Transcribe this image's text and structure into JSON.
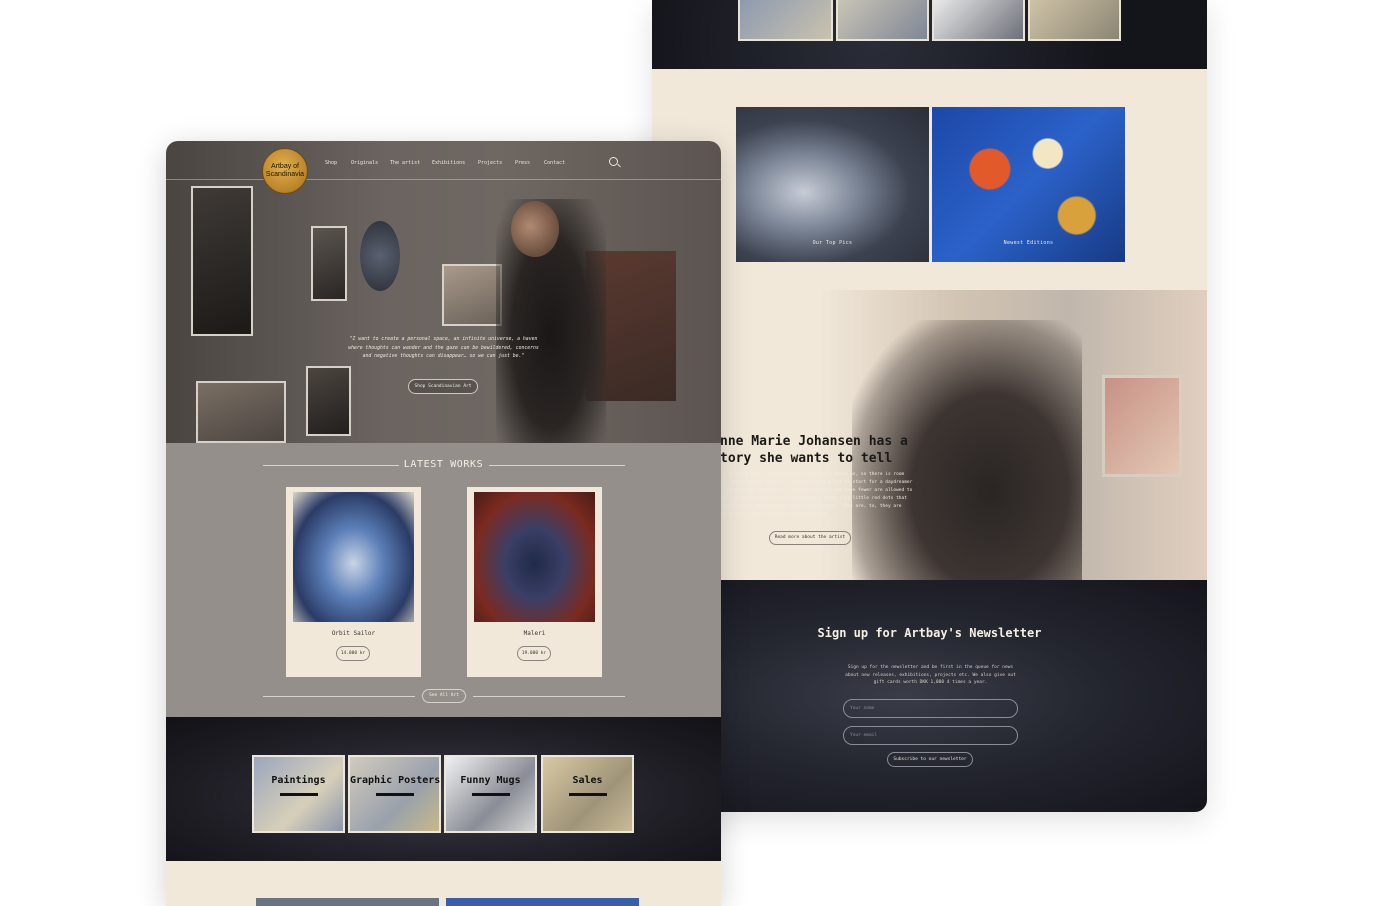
{
  "right": {
    "tiles": [
      {
        "label": "Our Top Pics"
      },
      {
        "label": "Newest Editions"
      }
    ],
    "story": {
      "headline_line1": "nne Marie Johansen has a",
      "headline_line2": "tory she wants to tell",
      "body": "'s about heaven, the great infinite space above us, so there is room for many stories and it is quite a good place to start for a daydreamer like her. Few insects are loved so fondly and even fewer are allowed to walk on your fingers, but ladybirds – those tiny little red dots that seem to keep wandering on your hand forever, they are, to, they are messengers, the carriers of good wishes.",
      "read_more": "Read more about the artist"
    },
    "newsletter": {
      "title": "Sign up for Artbay's Newsletter",
      "text": "Sign up for the newsletter and be first in the queue for news about new releases, exhibitions, projects etc. We also give out gift cards worth DKK 1,000 4 times a year.",
      "name_placeholder": "Your name",
      "email_placeholder": "Your email",
      "subscribe": "Subscribe to our newsletter"
    }
  },
  "left": {
    "logo": "Artbay of Scandinavia",
    "nav": [
      "Shop",
      "Originals",
      "The artist",
      "Exhibitions",
      "Projects",
      "Press",
      "Contact"
    ],
    "hero": {
      "quote": "\"I want to create a personal space, an infinite universe, a haven where thoughts can wander and the gaze can be bewildered, concerns and negative thoughts can disappear… so we can just be.\"",
      "cta": "Shop Scandinavian Art"
    },
    "latest": {
      "title": "LATEST WORKS",
      "items": [
        {
          "name": "Orbit Sailor",
          "price": "14.000 kr"
        },
        {
          "name": "Maleri",
          "price": "19.000 kr"
        }
      ],
      "see_all": "See All Art"
    },
    "categories": [
      "Paintings",
      "Graphic Posters",
      "Funny Mugs",
      "Sales"
    ]
  }
}
